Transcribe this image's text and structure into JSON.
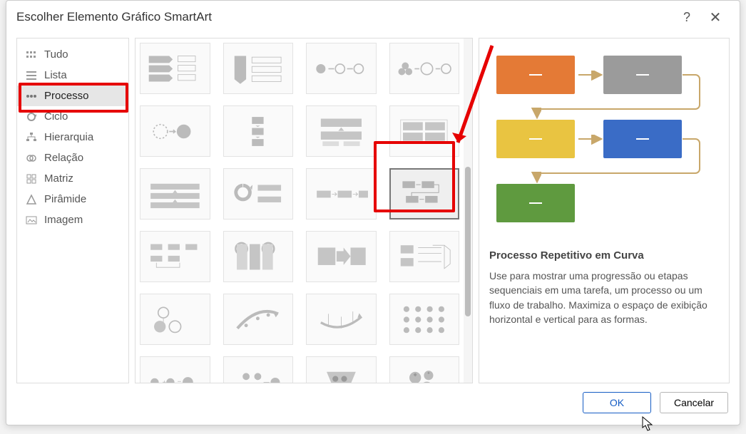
{
  "dialog": {
    "title": "Escolher Elemento Gráfico SmartArt",
    "help": "?",
    "close": "✕"
  },
  "sidebar": {
    "items": [
      {
        "label": "Tudo",
        "icon": "grid-icon"
      },
      {
        "label": "Lista",
        "icon": "list-icon"
      },
      {
        "label": "Processo",
        "icon": "process-icon",
        "selected": true
      },
      {
        "label": "Ciclo",
        "icon": "cycle-icon"
      },
      {
        "label": "Hierarquia",
        "icon": "hierarchy-icon"
      },
      {
        "label": "Relação",
        "icon": "relation-icon"
      },
      {
        "label": "Matriz",
        "icon": "matrix-icon"
      },
      {
        "label": "Pirâmide",
        "icon": "pyramid-icon"
      },
      {
        "label": "Imagem",
        "icon": "image-icon"
      }
    ]
  },
  "preview": {
    "title": "Processo Repetitivo em Curva",
    "description": "Use para mostrar uma progressão ou etapas sequenciais em uma tarefa, um processo ou um fluxo de trabalho. Maximiza o espaço de exibição horizontal e vertical para as formas.",
    "colors": {
      "shape1": "#e47a36",
      "shape2": "#9b9b9b",
      "shape3": "#e9c441",
      "shape4": "#3a6cc6",
      "shape5": "#5f9a3f",
      "connector": "#c8a76a"
    }
  },
  "gallery": {
    "selected_index": 11
  },
  "buttons": {
    "ok": "OK",
    "cancel": "Cancelar"
  }
}
